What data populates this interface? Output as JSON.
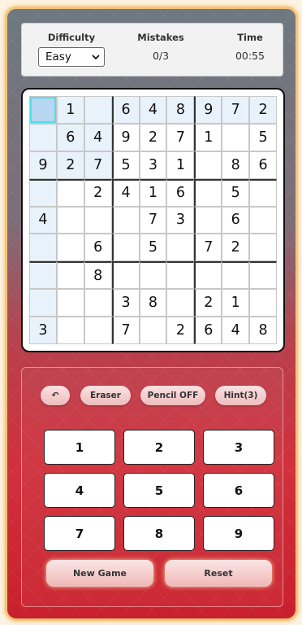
{
  "info": {
    "difficulty_label": "Difficulty",
    "difficulty_value": "Easy",
    "mistakes_label": "Mistakes",
    "mistakes_value": "0/3",
    "time_label": "Time",
    "time_value": "00:55"
  },
  "board": {
    "selected": [
      0,
      0
    ],
    "cells": [
      [
        "",
        "1",
        "",
        "6",
        "4",
        "8",
        "9",
        "7",
        "2"
      ],
      [
        "",
        "6",
        "4",
        "9",
        "2",
        "7",
        "1",
        "",
        "5"
      ],
      [
        "9",
        "2",
        "7",
        "5",
        "3",
        "1",
        "",
        "8",
        "6"
      ],
      [
        "",
        "",
        "2",
        "4",
        "1",
        "6",
        "",
        "5",
        ""
      ],
      [
        "4",
        "",
        "",
        "",
        "7",
        "3",
        "",
        "6",
        ""
      ],
      [
        "",
        "",
        "6",
        "",
        "5",
        "",
        "7",
        "2",
        ""
      ],
      [
        "",
        "",
        "8",
        "",
        "",
        "",
        "",
        "",
        ""
      ],
      [
        "",
        "",
        "",
        "3",
        "8",
        "",
        "2",
        "1",
        ""
      ],
      [
        "3",
        "",
        "",
        "7",
        "",
        "2",
        "6",
        "4",
        "8"
      ]
    ]
  },
  "tools": {
    "undo_label": "↶",
    "eraser_label": "Eraser",
    "pencil_label": "Pencil OFF",
    "hint_label": "Hint(3)"
  },
  "numpad": [
    "1",
    "2",
    "3",
    "4",
    "5",
    "6",
    "7",
    "8",
    "9"
  ],
  "actions": {
    "new_game_label": "New Game",
    "reset_label": "Reset"
  },
  "colors": {
    "selected_cell": "#b7d6f0",
    "highlight_cell": "#e8f2fb",
    "selected_border": "#4ee0e8",
    "accent": "#d0303c"
  }
}
